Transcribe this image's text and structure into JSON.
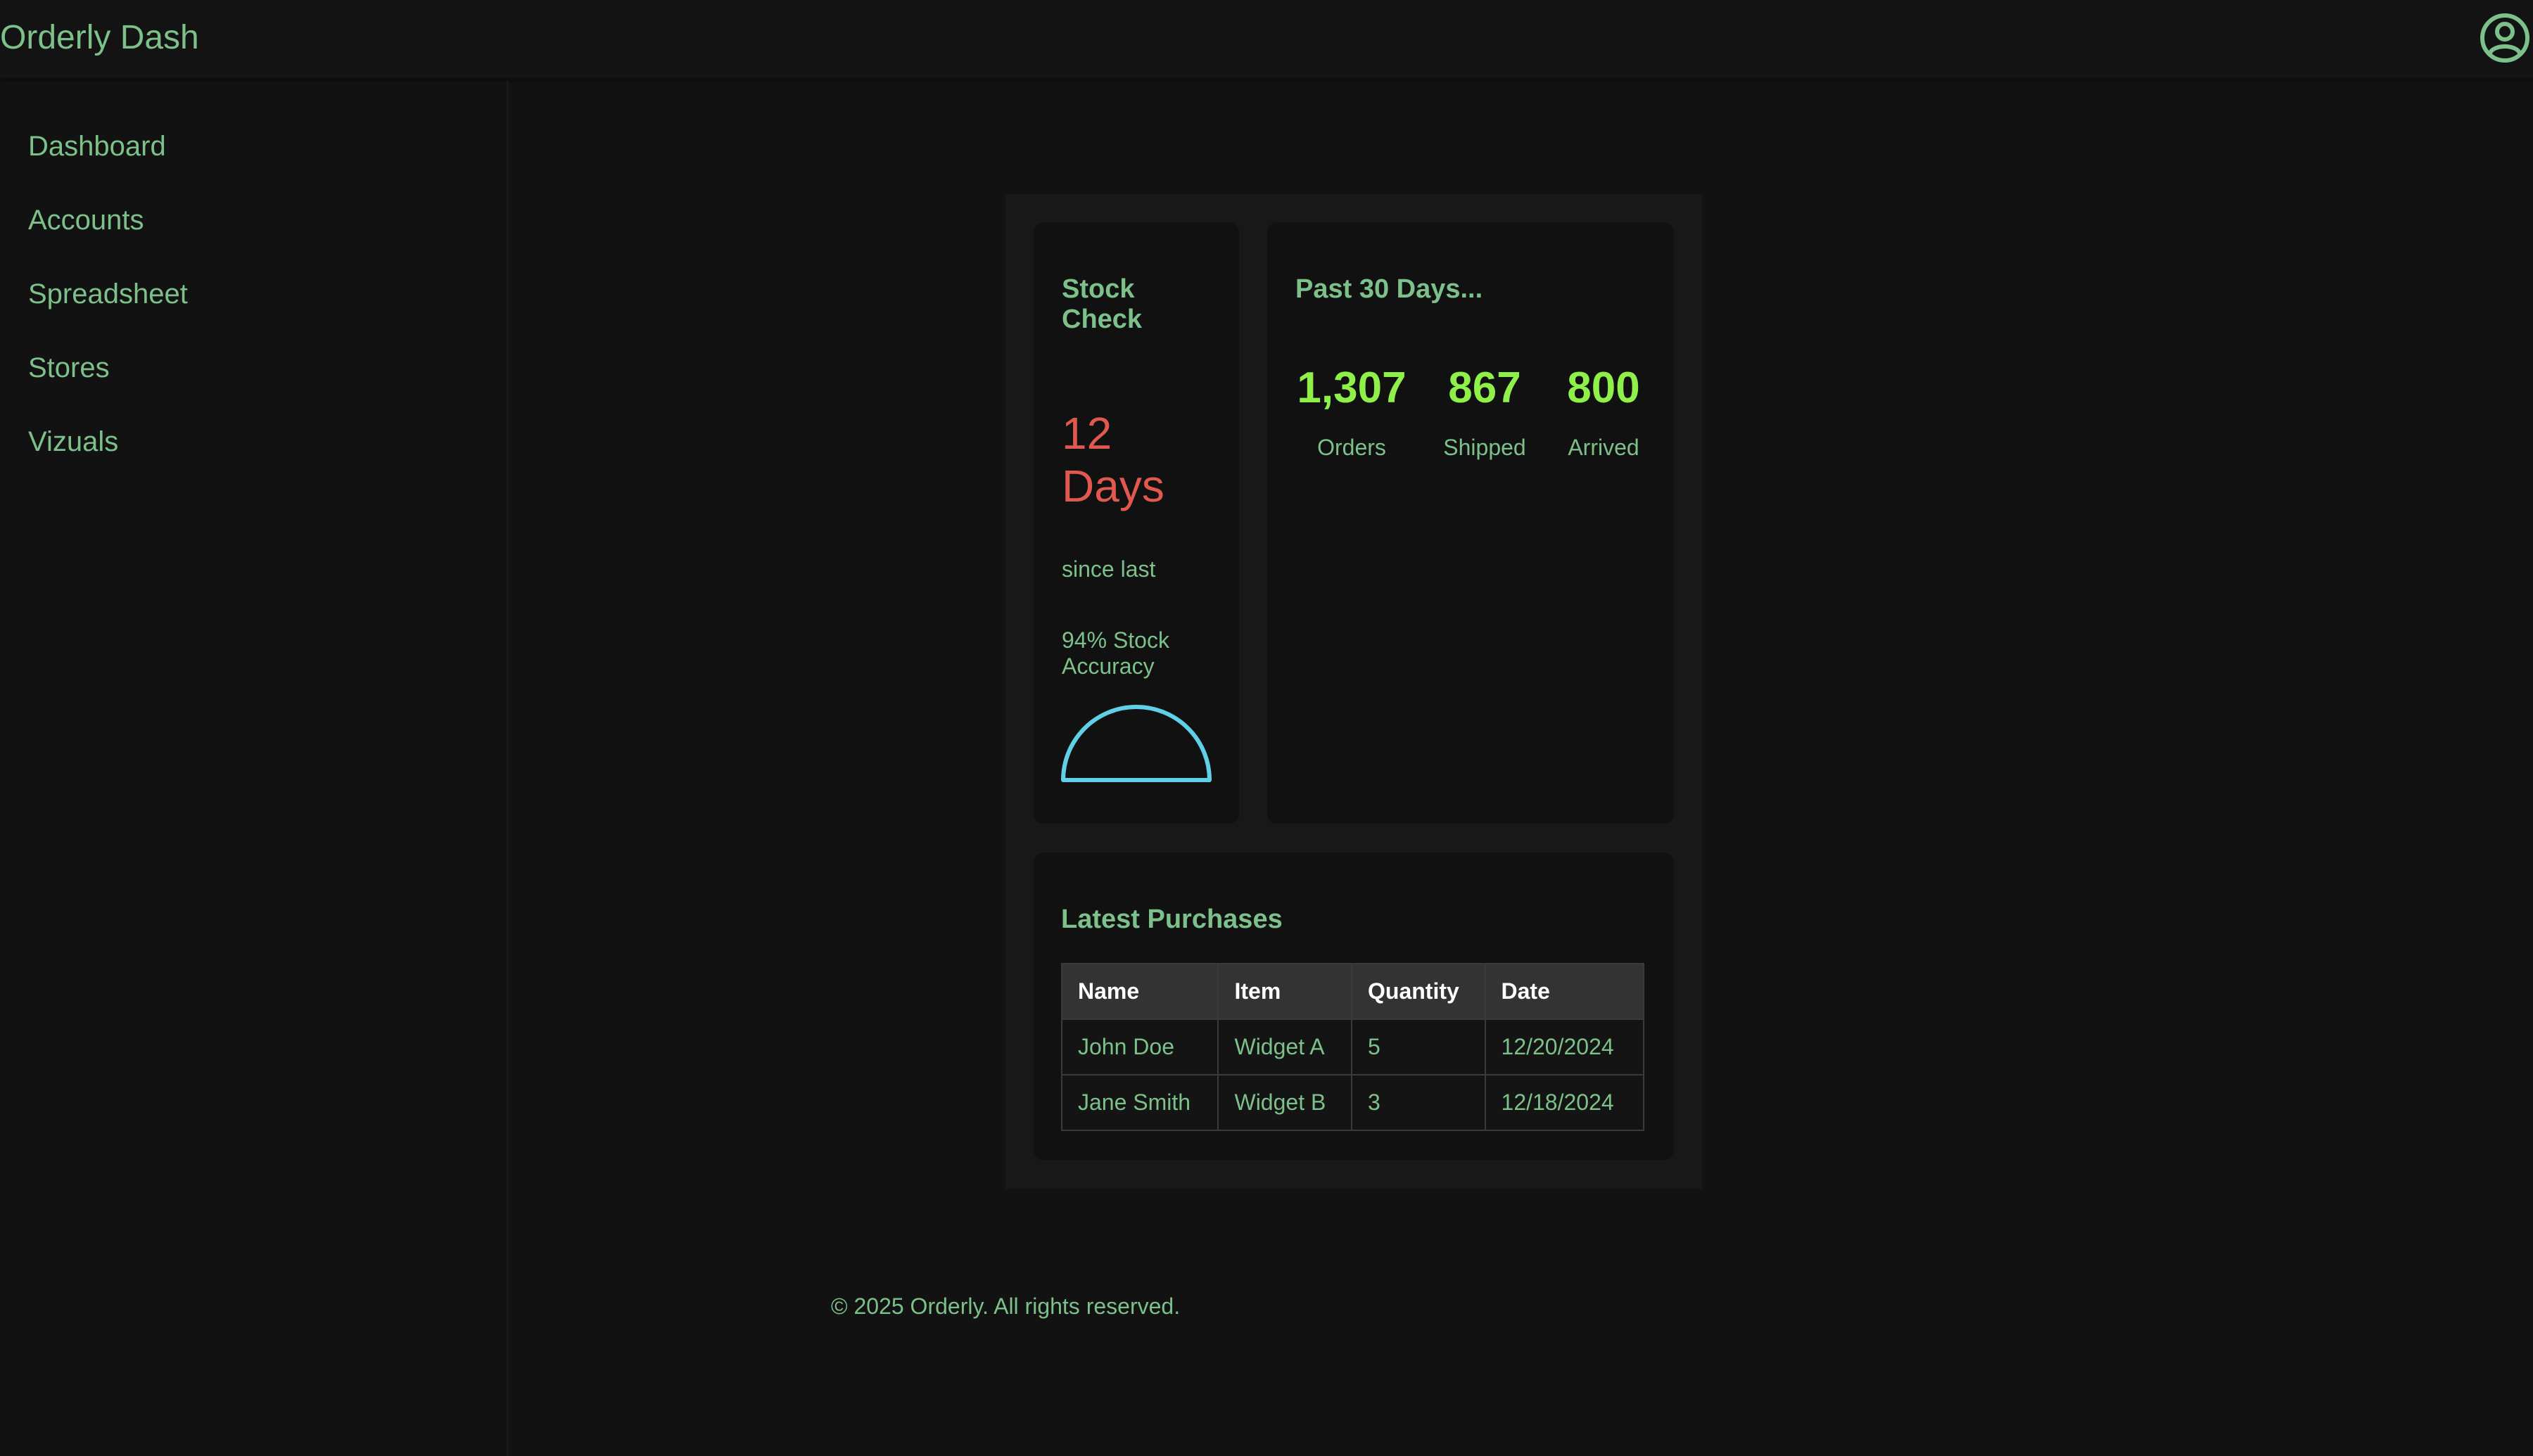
{
  "header": {
    "title": "Orderly Dash",
    "user_icon": "user-circle-icon"
  },
  "sidebar": {
    "items": [
      {
        "label": "Dashboard"
      },
      {
        "label": "Accounts"
      },
      {
        "label": "Spreadsheet"
      },
      {
        "label": "Stores"
      },
      {
        "label": "Vizuals"
      }
    ]
  },
  "stock_check": {
    "title_line1": "Stock",
    "title_line2": "Check",
    "days_number": "12",
    "days_unit": "Days",
    "since_label": "since last",
    "accuracy_line1": "94% Stock",
    "accuracy_line2": "Accuracy",
    "accuracy_value": 94,
    "gauge_color": "#5fd0e8"
  },
  "past_30": {
    "title": "Past 30 Days...",
    "stats": [
      {
        "value": "1,307",
        "label": "Orders"
      },
      {
        "value": "867",
        "label": "Shipped"
      },
      {
        "value": "800",
        "label": "Arrived"
      }
    ]
  },
  "purchases": {
    "title": "Latest Purchases",
    "columns": [
      "Name",
      "Item",
      "Quantity",
      "Date"
    ],
    "rows": [
      [
        "John Doe",
        "Widget A",
        "5",
        "12/20/2024"
      ],
      [
        "Jane Smith",
        "Widget B",
        "3",
        "12/18/2024"
      ]
    ]
  },
  "footer": {
    "text": "© 2025 Orderly. All rights reserved."
  },
  "colors": {
    "accent_text": "#7cc08a",
    "stat_green": "#8ff04a",
    "alert_red": "#e0584e",
    "gauge_cyan": "#5fd0e8"
  }
}
